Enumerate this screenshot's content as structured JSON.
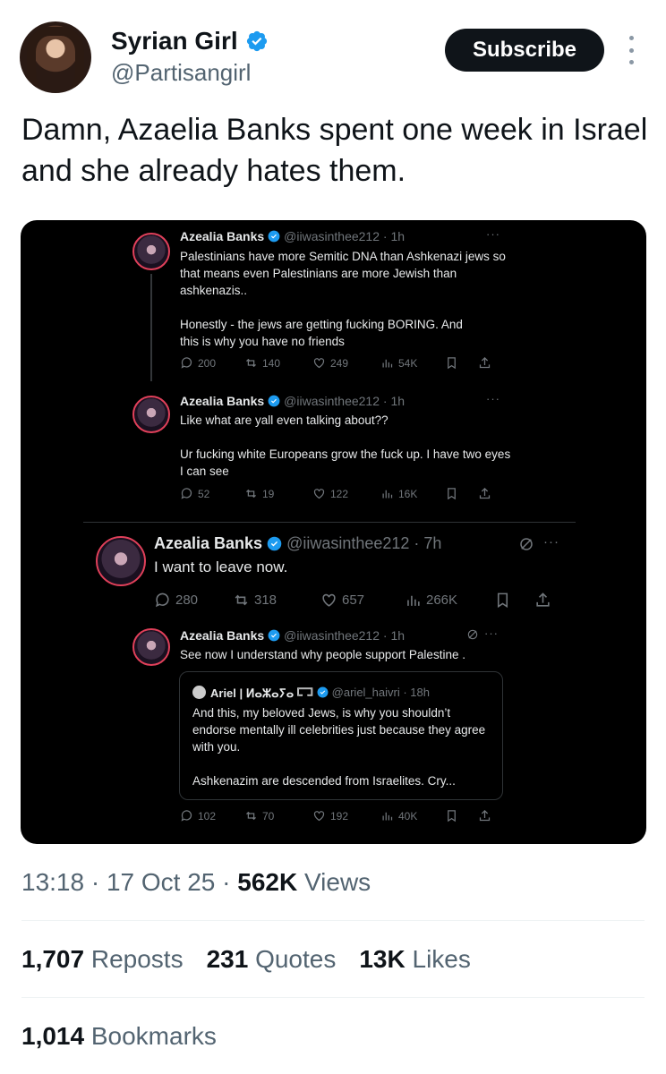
{
  "author": {
    "name": "Syrian Girl",
    "handle": "@Partisangirl",
    "subscribe_label": "Subscribe"
  },
  "tweet": {
    "text": "Damn, Azaelia Banks spent one week in Israel and she already hates them."
  },
  "embedded": {
    "posts": [
      {
        "name": "Azealia Banks",
        "handle": "@iiwasinthee212 · 1h",
        "text1": "Palestinians have more Semitic DNA than Ashkenazi jews so that means even Palestinians are more Jewish than ashkenazis..",
        "text2": "Honestly - the jews are getting fucking BORING. And this is why you have no friends",
        "replies": "200",
        "reposts": "140",
        "likes": "249",
        "views": "54K"
      },
      {
        "name": "Azealia Banks",
        "handle": "@iiwasinthee212 · 1h",
        "text1": "Like what are yall even talking about??",
        "text2": "Ur fucking white Europeans grow the fuck up. I have two eyes I can see",
        "replies": "52",
        "reposts": "19",
        "likes": "122",
        "views": "16K"
      },
      {
        "name": "Azealia Banks",
        "handle": "@iiwasinthee212 · 7h",
        "text1": "I want to leave now.",
        "replies": "280",
        "reposts": "318",
        "likes": "657",
        "views": "266K"
      },
      {
        "name": "Azealia Banks",
        "handle": "@iiwasinthee212 · 1h",
        "text1": "See now I understand why people support Palestine .",
        "quote": {
          "name": "Ariel | ⵍⴰⵣⴰⵢⴰ 𓉐",
          "handle": "@ariel_haivri · 18h",
          "text1": "And this, my beloved Jews, is why you shouldn’t endorse mentally ill celebrities just because they agree with you.",
          "text2": "Ashkenazim are descended from Israelites. Cry..."
        },
        "replies": "102",
        "reposts": "70",
        "likes": "192",
        "views": "40K"
      }
    ],
    "more_glyph": "···"
  },
  "meta": {
    "time": "13:18",
    "date": "17 Oct 25",
    "views_count": "562K",
    "views_label": "Views",
    "dot": "·"
  },
  "stats": {
    "reposts_count": "1,707",
    "reposts_label": "Reposts",
    "quotes_count": "231",
    "quotes_label": "Quotes",
    "likes_count": "13K",
    "likes_label": "Likes",
    "bookmarks_count": "1,014",
    "bookmarks_label": "Bookmarks"
  },
  "colors": {
    "verified": "#1d9bf0",
    "text_primary": "#0f1419",
    "text_secondary": "#536471",
    "media_bg": "#000000"
  },
  "icons": [
    "verified-badge-icon",
    "more-vertical-icon",
    "reply-icon",
    "repost-icon",
    "like-icon",
    "views-icon",
    "bookmark-icon",
    "share-icon",
    "grok-icon"
  ]
}
